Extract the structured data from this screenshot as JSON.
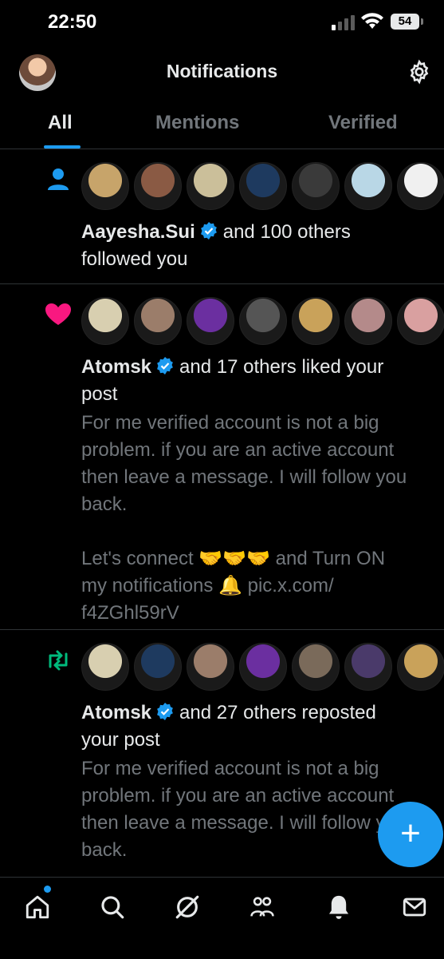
{
  "status": {
    "time": "22:50",
    "battery": "54"
  },
  "header": {
    "title": "Notifications"
  },
  "tabs": [
    {
      "label": "All",
      "active": true
    },
    {
      "label": "Mentions",
      "active": false
    },
    {
      "label": "Verified",
      "active": false
    }
  ],
  "notifications": [
    {
      "type": "follow",
      "user": "Aayesha.Sui",
      "text": "and 100 others",
      "text2": "followed you",
      "avatar_colors": [
        "#c7a46a",
        "#8a5a44",
        "#cbbf9a",
        "#1e3a5f",
        "#3a3a3a",
        "#b9d7e6",
        "#f0f0f0"
      ]
    },
    {
      "type": "like",
      "user": "Atomsk",
      "text": "and 17 others liked your",
      "text2": "post",
      "avatar_colors": [
        "#d8cfb0",
        "#9b7d6a",
        "#6b2fa0",
        "#555555",
        "#c9a25a",
        "#b48a8a",
        "#d9a0a0"
      ],
      "post_lines": [
        "For me verified account is not a big",
        "problem. if you are an active account",
        "then leave a message. I will follow you",
        "back.",
        "",
        "Let's connect 🤝🤝🤝 and Turn ON",
        "my notifications 🔔 pic.x.com/",
        "f4ZGhl59rV"
      ]
    },
    {
      "type": "repost",
      "user": "Atomsk",
      "text": "and 27 others reposted",
      "text2": "your post",
      "avatar_colors": [
        "#d8cfb0",
        "#1e3a5f",
        "#9b7d6a",
        "#6b2fa0",
        "#7a6a5a",
        "#4a3a6a",
        "#c9a25a"
      ],
      "post_lines": [
        "For me verified account is not a big",
        "problem. if you are an active account",
        "then leave a message. I will follow you",
        "back."
      ]
    }
  ],
  "colors": {
    "accent": "#1d9bf0",
    "like": "#f91880",
    "repost": "#00ba7c",
    "muted": "#71767b"
  },
  "nav": [
    "home-icon",
    "search-icon",
    "grok-icon",
    "communities-icon",
    "notifications-icon",
    "messages-icon"
  ]
}
